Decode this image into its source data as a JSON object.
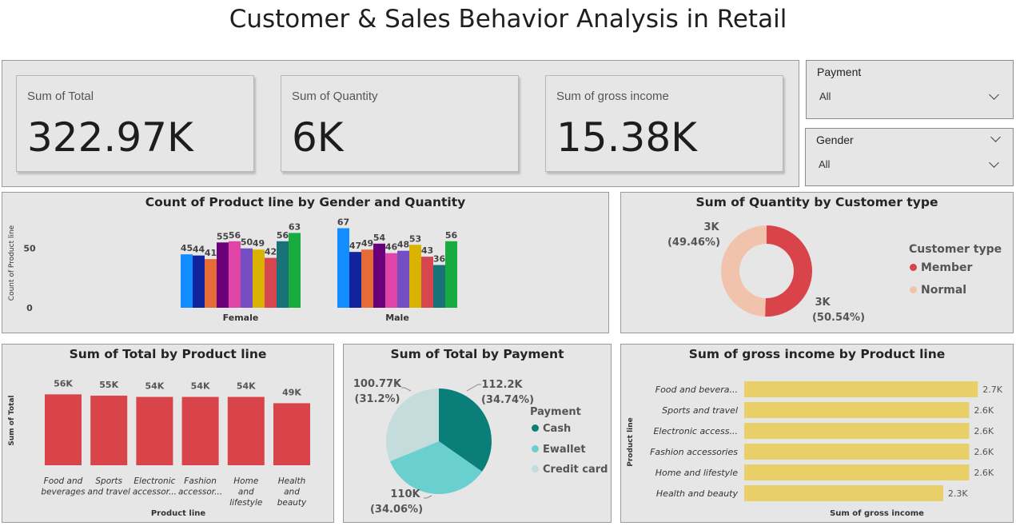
{
  "title": "Customer & Sales Behavior Analysis in Retail",
  "kpis": [
    {
      "label": "Sum of Total",
      "value": "322.97K"
    },
    {
      "label": "Sum of Quantity",
      "value": "6K"
    },
    {
      "label": "Sum of gross income",
      "value": "15.38K"
    }
  ],
  "slicers": {
    "payment": {
      "title": "Payment",
      "value": "All"
    },
    "gender": {
      "title": "Gender",
      "value": "All"
    }
  },
  "colors": {
    "red": "#d9444b",
    "teal": "#0a7f7a",
    "aqua": "#6acfcf",
    "light": "#c4dcdc",
    "peach": "#f2c3ac",
    "yellow": "#e8cf67"
  },
  "chart_data": [
    {
      "type": "bar",
      "title": "Count of Product line by Gender and Quantity",
      "ylabel": "Count of Product line",
      "yticks": [
        "0",
        "50"
      ],
      "ylim": [
        0,
        70
      ],
      "categories": [
        "Female",
        "Male"
      ],
      "series": [
        {
          "color": "#118dff",
          "values": [
            45,
            67
          ]
        },
        {
          "color": "#12239e",
          "values": [
            44,
            47
          ]
        },
        {
          "color": "#e66c37",
          "values": [
            41,
            49
          ]
        },
        {
          "color": "#6b007b",
          "values": [
            55,
            54
          ]
        },
        {
          "color": "#e044a7",
          "values": [
            56,
            46
          ]
        },
        {
          "color": "#744ec2",
          "values": [
            50,
            48
          ]
        },
        {
          "color": "#d9b300",
          "values": [
            49,
            53
          ]
        },
        {
          "color": "#d64550",
          "values": [
            42,
            43
          ]
        },
        {
          "color": "#197278",
          "values": [
            56,
            36
          ]
        },
        {
          "color": "#1aab40",
          "values": [
            63,
            56
          ]
        }
      ]
    },
    {
      "type": "pie",
      "title": "Sum of Quantity by Customer type",
      "legend_title": "Customer type",
      "slices": [
        {
          "name": "Member",
          "value": 3000,
          "label": "3K",
          "pct": "(50.54%)",
          "percent": 50.54,
          "color": "#d9444b"
        },
        {
          "name": "Normal",
          "value": 3000,
          "label": "3K",
          "pct": "(49.46%)",
          "percent": 49.46,
          "color": "#f2c3ac"
        }
      ]
    },
    {
      "type": "bar",
      "title": "Sum of Total by Product line",
      "xlabel": "Product line",
      "ylabel": "Sum of Total",
      "categories": [
        [
          "Food and",
          "beverages"
        ],
        [
          "Sports",
          "and travel"
        ],
        [
          "Electronic",
          "accessor..."
        ],
        [
          "Fashion",
          "accessor..."
        ],
        [
          "Home",
          "and",
          "lifestyle"
        ],
        [
          "Health",
          "and",
          "beauty"
        ]
      ],
      "values": [
        56,
        55,
        54,
        54,
        54,
        49
      ],
      "labels": [
        "56K",
        "55K",
        "54K",
        "54K",
        "54K",
        "49K"
      ],
      "ylim": [
        0,
        60
      ]
    },
    {
      "type": "pie",
      "title": "Sum of Total by Payment",
      "legend_title": "Payment",
      "slices": [
        {
          "name": "Cash",
          "value": 112.2,
          "label": "112.2K",
          "pct": "(34.74%)",
          "percent": 34.74,
          "color": "#0a7f7a"
        },
        {
          "name": "Ewallet",
          "value": 110,
          "label": "110K",
          "pct": "(34.06%)",
          "percent": 34.06,
          "color": "#6acfcf"
        },
        {
          "name": "Credit card",
          "value": 100.77,
          "label": "100.77K",
          "pct": "(31.2%)",
          "percent": 31.2,
          "color": "#c4dcdc"
        }
      ]
    },
    {
      "type": "bar",
      "orientation": "horizontal",
      "title": "Sum of gross income by Product line",
      "xlabel": "Sum of gross income",
      "ylabel": "Product line",
      "categories": [
        "Food and bevera...",
        "Sports and travel",
        "Electronic access...",
        "Fashion accessories",
        "Home and lifestyle",
        "Health and beauty"
      ],
      "values": [
        2.7,
        2.6,
        2.6,
        2.6,
        2.6,
        2.3
      ],
      "labels": [
        "2.7K",
        "2.6K",
        "2.6K",
        "2.6K",
        "2.6K",
        "2.3K"
      ],
      "xlim": [
        0,
        2.8
      ]
    }
  ]
}
